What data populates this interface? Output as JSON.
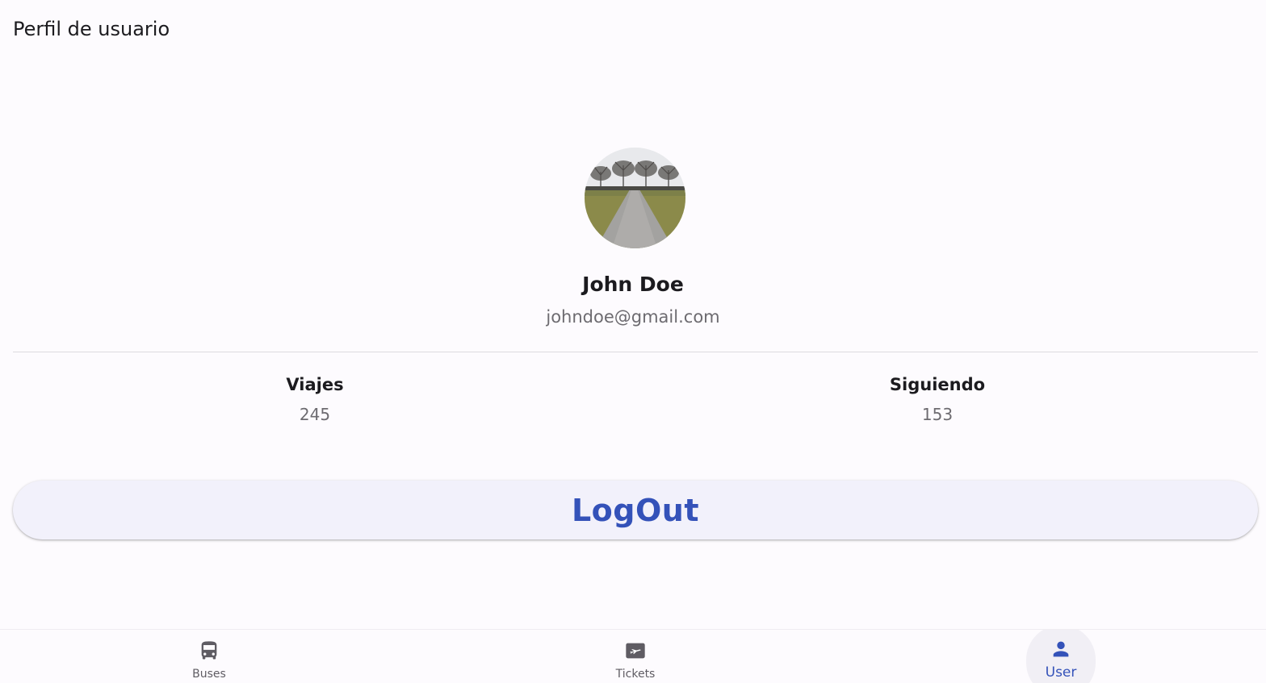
{
  "app_bar": {
    "title": "Perfil de usuario"
  },
  "profile": {
    "avatar_icon": "landscape-photo-avatar",
    "name": "John Doe",
    "email": "johndoe@gmail.com"
  },
  "stats": [
    {
      "label": "Viajes",
      "value": "245"
    },
    {
      "label": "Siguiendo",
      "value": "153"
    }
  ],
  "logout_button": {
    "label": "LogOut"
  },
  "bottom_nav": {
    "selected": "User",
    "items": [
      {
        "label": "Buses",
        "icon": "bus-icon"
      },
      {
        "label": "Tickets",
        "icon": "airplane-ticket-icon"
      },
      {
        "label": "User",
        "icon": "person-icon"
      }
    ]
  },
  "colors": {
    "primary": "#3452b9",
    "background": "#fdfbfe",
    "button_background": "#f2f1fb",
    "secondary_text": "#6d6b70"
  }
}
